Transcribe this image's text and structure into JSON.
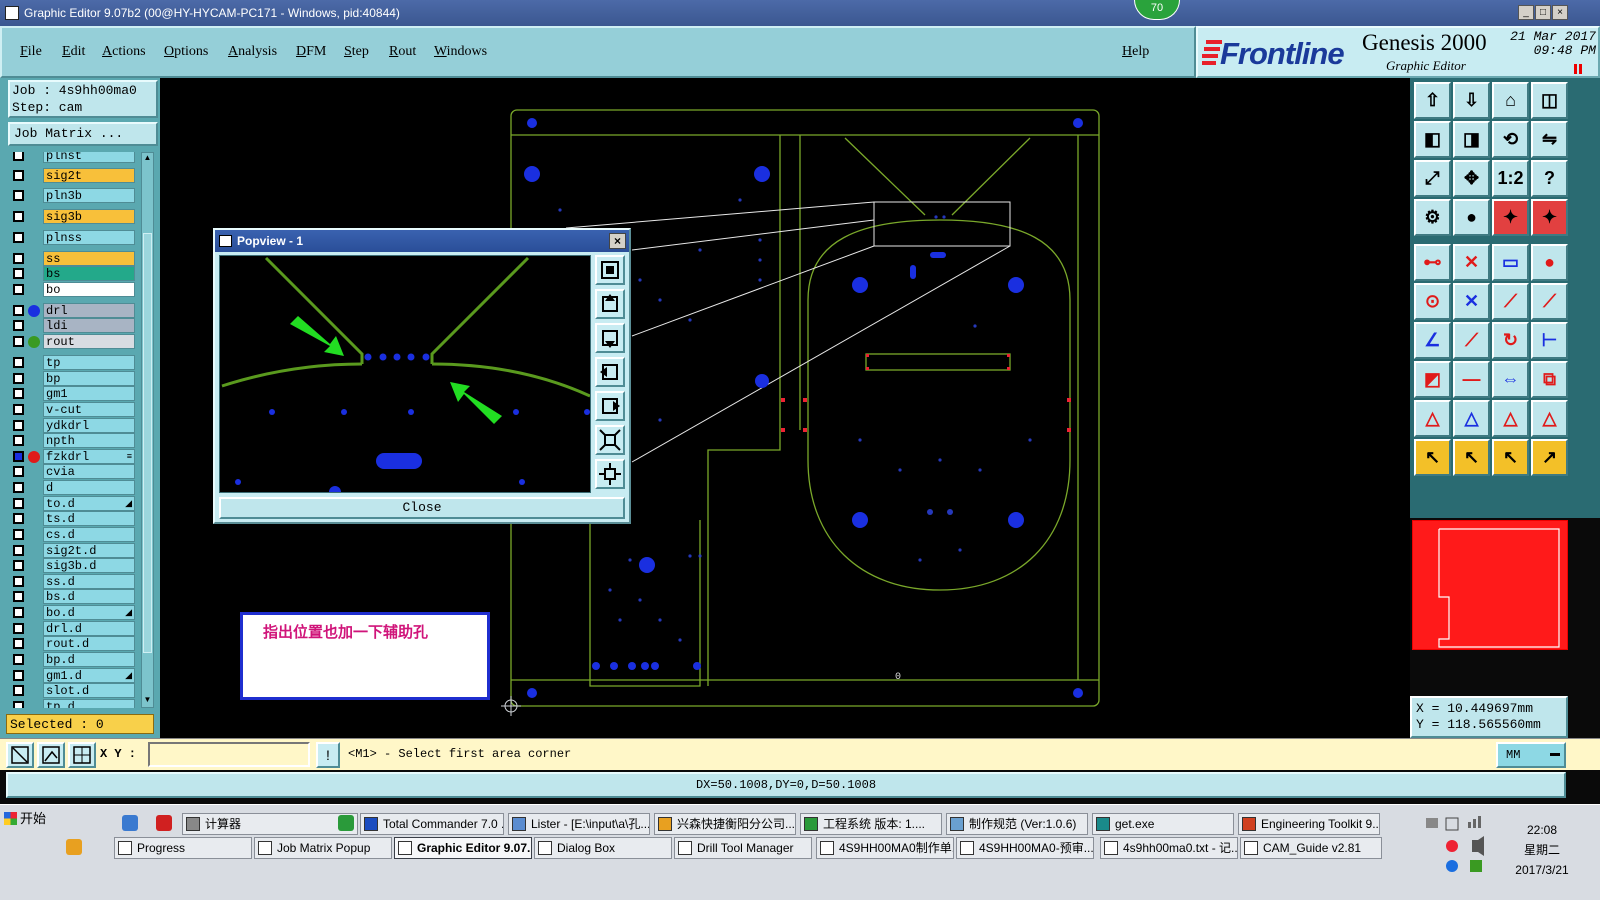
{
  "window": {
    "title": "Graphic Editor 9.07b2 (00@HY-HYCAM-PC171 - Windows, pid:40844)",
    "badge": "70"
  },
  "menu": [
    "File",
    "Edit",
    "Actions",
    "Options",
    "Analysis",
    "DFM",
    "Step",
    "Rout",
    "Windows"
  ],
  "menu_help": "Help",
  "brand": {
    "logo": "Frontline",
    "product": "Genesis 2000",
    "subtitle": "Graphic Editor",
    "date": "21 Mar 2017",
    "time": "09:48 PM"
  },
  "job": {
    "job_label": "Job : 4s9hh00ma0",
    "step_label": "Step: cam",
    "matrix_button": "Job Matrix ..."
  },
  "layers": [
    {
      "name": "plnst",
      "color": "#8dd8e4",
      "dot": ""
    },
    {
      "name": "sig2t",
      "color": "#f8c03a",
      "dot": ""
    },
    {
      "name": "pln3b",
      "color": "#8dd8e4",
      "dot": ""
    },
    {
      "name": "sig3b",
      "color": "#f8c03a",
      "dot": ""
    },
    {
      "name": "plnss",
      "color": "#8dd8e4",
      "dot": ""
    },
    {
      "name": "ss",
      "color": "#f8c03a",
      "dot": ""
    },
    {
      "name": "bs",
      "color": "#23a98a",
      "dot": ""
    },
    {
      "name": "bo",
      "color": "#ffffff",
      "dot": ""
    },
    {
      "name": "drl",
      "color": "#a8b4c4",
      "dot": "#1a2fe0"
    },
    {
      "name": "ldi",
      "color": "#a8b4c4",
      "dot": ""
    },
    {
      "name": "rout",
      "color": "#d8dce2",
      "dot": "#3a9a22"
    },
    {
      "name": "tp",
      "color": "#8dd8e4",
      "dot": ""
    },
    {
      "name": "bp",
      "color": "#8dd8e4",
      "dot": ""
    },
    {
      "name": "gm1",
      "color": "#8dd8e4",
      "dot": ""
    },
    {
      "name": "v-cut",
      "color": "#8dd8e4",
      "dot": ""
    },
    {
      "name": "ydkdrl",
      "color": "#8dd8e4",
      "dot": ""
    },
    {
      "name": "npth",
      "color": "#8dd8e4",
      "dot": ""
    },
    {
      "name": "fzkdrl",
      "color": "#8dd8e4",
      "dot": "#e01a1a"
    },
    {
      "name": "cvia",
      "color": "#8dd8e4",
      "dot": ""
    },
    {
      "name": "d",
      "color": "#8dd8e4",
      "dot": ""
    },
    {
      "name": "to.d",
      "color": "#8dd8e4",
      "dot": ""
    },
    {
      "name": "ts.d",
      "color": "#8dd8e4",
      "dot": ""
    },
    {
      "name": "cs.d",
      "color": "#8dd8e4",
      "dot": ""
    },
    {
      "name": "sig2t.d",
      "color": "#8dd8e4",
      "dot": ""
    },
    {
      "name": "sig3b.d",
      "color": "#8dd8e4",
      "dot": ""
    },
    {
      "name": "ss.d",
      "color": "#8dd8e4",
      "dot": ""
    },
    {
      "name": "bs.d",
      "color": "#8dd8e4",
      "dot": ""
    },
    {
      "name": "bo.d",
      "color": "#8dd8e4",
      "dot": ""
    },
    {
      "name": "drl.d",
      "color": "#8dd8e4",
      "dot": ""
    },
    {
      "name": "rout.d",
      "color": "#8dd8e4",
      "dot": ""
    },
    {
      "name": "bp.d",
      "color": "#8dd8e4",
      "dot": ""
    },
    {
      "name": "gm1.d",
      "color": "#8dd8e4",
      "dot": ""
    },
    {
      "name": "slot.d",
      "color": "#8dd8e4",
      "dot": ""
    },
    {
      "name": "tp.d",
      "color": "#8dd8e4",
      "dot": ""
    }
  ],
  "selected": "Selected : 0",
  "popview": {
    "title": "Popview - 1",
    "close_button": "Close"
  },
  "note": "指出位置也加一下辅助孔",
  "coords": {
    "x": "X =  10.449697mm",
    "y": "Y = 118.565560mm"
  },
  "cmdbar": {
    "xy_label": "X Y :",
    "xy_value": "",
    "prompt": "<M1> - Select first area corner",
    "unit": "MM"
  },
  "status": "DX=50.1008,DY=0,D=50.1008",
  "toolbar_grid": [
    "",
    "",
    "",
    "",
    "",
    "",
    "",
    "",
    "",
    "",
    "1:2",
    "?",
    "",
    "",
    "",
    "",
    "",
    "",
    "",
    "",
    "",
    "",
    "",
    "",
    "",
    "",
    "",
    "",
    "",
    "",
    "",
    "",
    "",
    "",
    "",
    "",
    "",
    "",
    "",
    ""
  ],
  "taskbar": {
    "start": "开始",
    "row1": [
      "计算器",
      "Total Commander 7.0 ...",
      "Lister - [E:\\input\\a\\孔...",
      "兴森快捷衡阳分公司...",
      "工程系统  版本: 1....",
      "制作规范 (Ver:1.0.6)",
      "get.exe",
      "Engineering Toolkit 9...."
    ],
    "row2": [
      "Progress",
      "Job Matrix Popup",
      "Graphic Editor 9.07...",
      "Dialog Box",
      "Drill Tool Manager",
      "4S9HH00MA0制作单...",
      "4S9HH00MA0-预审...",
      "4s9hh00ma0.txt - 记...",
      "CAM_Guide v2.81"
    ],
    "clock_time": "22:08",
    "clock_day": "星期二",
    "clock_date": "2017/3/21"
  }
}
